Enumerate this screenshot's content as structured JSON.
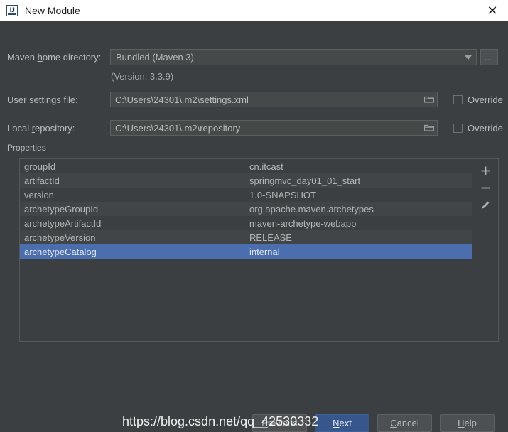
{
  "window": {
    "title": "New Module",
    "app_icon": "intellij-idea-icon",
    "close_label": "✕"
  },
  "form": {
    "maven_home": {
      "label_pre": "Maven ",
      "label_mnemonic": "h",
      "label_post": "ome directory:",
      "value": "Bundled (Maven 3)",
      "browse_label": "...",
      "version_note": "(Version: 3.3.9)"
    },
    "user_settings": {
      "label_pre": "User ",
      "label_mnemonic": "s",
      "label_post": "ettings file:",
      "value": "C:\\Users\\24301\\.m2\\settings.xml",
      "override_label": "Override",
      "override_checked": false
    },
    "local_repository": {
      "label_pre": "Local ",
      "label_mnemonic": "r",
      "label_post": "epository:",
      "value": "C:\\Users\\24301\\.m2\\repository",
      "override_label": "Override",
      "override_checked": false
    }
  },
  "properties": {
    "group_title": "Properties",
    "selected_index": 6,
    "rows": [
      {
        "key": "groupId",
        "value": "cn.itcast"
      },
      {
        "key": "artifactId",
        "value": "springmvc_day01_01_start"
      },
      {
        "key": "version",
        "value": "1.0-SNAPSHOT"
      },
      {
        "key": "archetypeGroupId",
        "value": "org.apache.maven.archetypes"
      },
      {
        "key": "archetypeArtifactId",
        "value": "maven-archetype-webapp"
      },
      {
        "key": "archetypeVersion",
        "value": "RELEASE"
      },
      {
        "key": "archetypeCatalog",
        "value": "internal"
      }
    ],
    "toolbar": {
      "add_label": "+",
      "remove_label": "−",
      "edit_label": "edit-pencil-icon"
    }
  },
  "footer": {
    "previous": {
      "pre": "",
      "mnemonic": "P",
      "post": "revious"
    },
    "next": {
      "pre": "",
      "mnemonic": "N",
      "post": "ext"
    },
    "cancel": {
      "pre": "",
      "mnemonic": "C",
      "post": "ancel"
    },
    "help": {
      "pre": "",
      "mnemonic": "H",
      "post": "elp"
    }
  },
  "watermark": {
    "text": "https://blog.csdn.net/qq_42530332"
  },
  "colors": {
    "dialog_bg": "#3c3f41",
    "field_bg": "#45494a",
    "selection": "#4b6eaf",
    "default_button": "#36568c",
    "text": "#bbbbbb",
    "titlebar_bg": "#ffffff"
  }
}
